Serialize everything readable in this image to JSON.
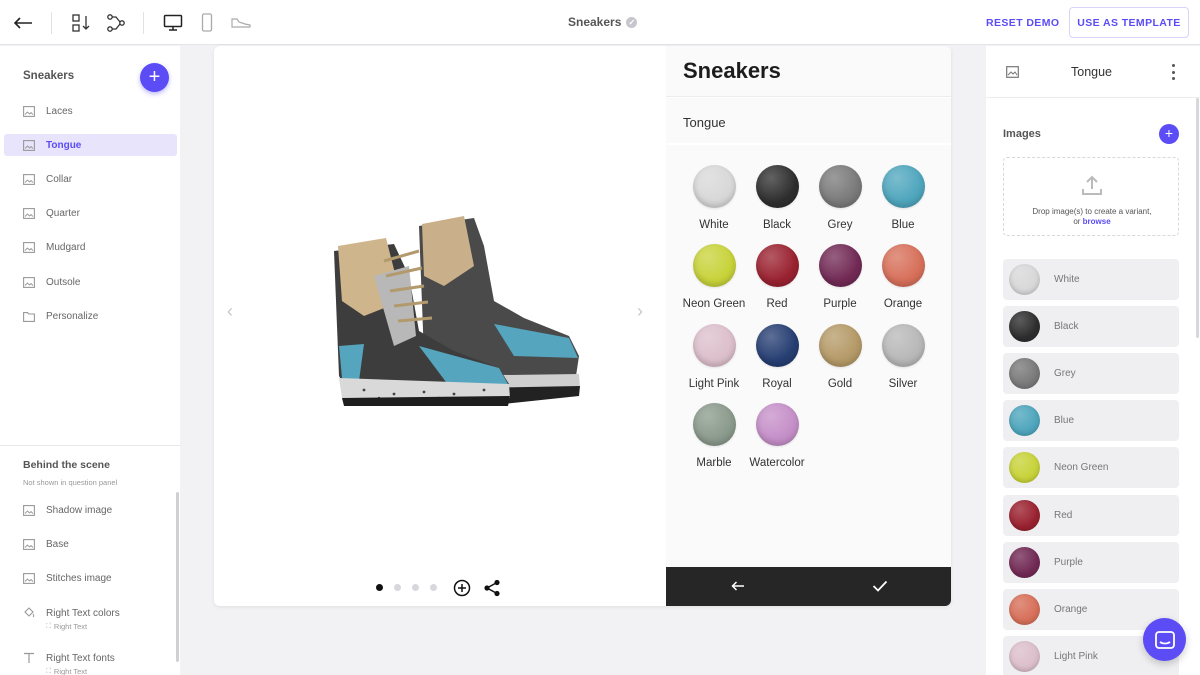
{
  "topbar": {
    "title": "Sneakers",
    "reset_label": "RESET DEMO",
    "template_label": "USE AS TEMPLATE",
    "icons": [
      "back-arrow-icon",
      "sort-layers-icon",
      "logic-flow-icon",
      "desktop-icon",
      "mobile-icon",
      "shoe-icon"
    ]
  },
  "sidebar": {
    "title": "Sneakers",
    "items": [
      {
        "label": "Laces",
        "icon": "image-icon"
      },
      {
        "label": "Tongue",
        "icon": "image-icon",
        "active": true
      },
      {
        "label": "Collar",
        "icon": "image-icon"
      },
      {
        "label": "Quarter",
        "icon": "image-icon"
      },
      {
        "label": "Mudgard",
        "icon": "image-icon"
      },
      {
        "label": "Outsole",
        "icon": "image-icon"
      },
      {
        "label": "Personalize",
        "icon": "folder-icon"
      }
    ],
    "behind": {
      "title": "Behind the scene",
      "subtitle": "Not shown in question panel",
      "items": [
        {
          "label": "Shadow image",
          "icon": "image-icon"
        },
        {
          "label": "Base",
          "icon": "image-icon"
        },
        {
          "label": "Stitches image",
          "icon": "image-icon"
        },
        {
          "label": "Right Text colors",
          "icon": "paint-bucket-icon",
          "sub": "Right Text"
        },
        {
          "label": "Right Text fonts",
          "icon": "text-icon",
          "sub": "Right Text"
        }
      ]
    }
  },
  "preview": {
    "title": "Sneakers",
    "section": "Tongue",
    "swatches": [
      {
        "label": "White",
        "color": "#d8d8d8"
      },
      {
        "label": "Black",
        "color": "#2e2e2e"
      },
      {
        "label": "Grey",
        "color": "#7a7a7a"
      },
      {
        "label": "Blue",
        "color": "#4fa6bd"
      },
      {
        "label": "Neon Green",
        "color": "#c8d33a"
      },
      {
        "label": "Red",
        "color": "#9a2230"
      },
      {
        "label": "Purple",
        "color": "#722a55"
      },
      {
        "label": "Orange",
        "color": "#d7705a"
      },
      {
        "label": "Light Pink",
        "color": "#dcbfcb"
      },
      {
        "label": "Royal",
        "color": "#263e72"
      },
      {
        "label": "Gold",
        "color": "#b59a68"
      },
      {
        "label": "Silver",
        "color": "#b8b8b8"
      },
      {
        "label": "Marble",
        "color": "#8a9a8c"
      },
      {
        "label": "Watercolor",
        "color": "#c58fc8"
      }
    ],
    "carousel": {
      "pages": 4,
      "current": 1
    }
  },
  "right_panel": {
    "title": "Tongue",
    "images_label": "Images",
    "drop_text": "Drop image(s) to create a variant,",
    "drop_or": "or",
    "browse": "browse",
    "variants": [
      {
        "label": "White",
        "color": "#d8d8d8"
      },
      {
        "label": "Black",
        "color": "#2e2e2e"
      },
      {
        "label": "Grey",
        "color": "#7a7a7a"
      },
      {
        "label": "Blue",
        "color": "#4fa6bd"
      },
      {
        "label": "Neon Green",
        "color": "#c8d33a"
      },
      {
        "label": "Red",
        "color": "#9a2230"
      },
      {
        "label": "Purple",
        "color": "#722a55"
      },
      {
        "label": "Orange",
        "color": "#d7705a"
      },
      {
        "label": "Light Pink",
        "color": "#dcbfcb"
      }
    ]
  },
  "colors": {
    "accent": "#5b4cf5",
    "footer": "#262626"
  }
}
